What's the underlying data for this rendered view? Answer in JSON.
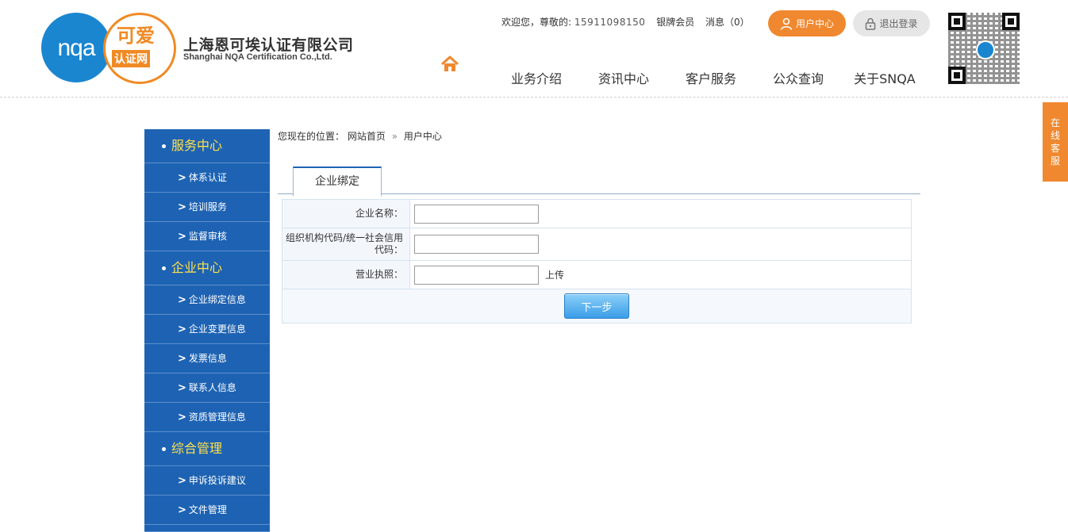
{
  "header": {
    "logo_left_text": "nqa",
    "logo_right_line1": "可爱",
    "logo_right_line2": "认证网",
    "company_cn": "上海恩可埃认证有限公司",
    "company_en": "Shanghai NQA Certification Co.,Ltd.",
    "welcome_prefix": "欢迎您，尊敬的:",
    "phone": "15911098150",
    "member_level": "银牌会员",
    "messages": "消息（0）",
    "user_center_label": "用户中心",
    "logout_label": "退出登录",
    "nav": [
      "业务介绍",
      "资讯中心",
      "客户服务",
      "公众查询",
      "关于SNQA"
    ]
  },
  "sidebar": {
    "sections": [
      {
        "title": "服务中心",
        "items": [
          "体系认证",
          "培训服务",
          "监督审核"
        ]
      },
      {
        "title": "企业中心",
        "items": [
          "企业绑定信息",
          "企业变更信息",
          "发票信息",
          "联系人信息",
          "资质管理信息"
        ]
      },
      {
        "title": "综合管理",
        "items": [
          "申诉投诉建议",
          "文件管理"
        ]
      }
    ]
  },
  "breadcrumb": {
    "prefix": "您现在的位置：",
    "home": "网站首页",
    "separator": "»",
    "current": "用户中心"
  },
  "tab": {
    "label": "企业绑定"
  },
  "form": {
    "company_name_label": "企业名称：",
    "company_name_value": "",
    "org_code_label": "组织机构代码/统一社会信用代码：",
    "org_code_value": "",
    "license_label": "营业执照：",
    "license_value": "",
    "upload_label": "上传",
    "next_label": "下一步"
  },
  "float_service": [
    "在",
    "线",
    "客",
    "服"
  ],
  "colors": {
    "brand_blue": "#1a86d0",
    "sidebar_blue": "#1e63b3",
    "accent_orange": "#f0882f",
    "sidebar_title_yellow": "#ffe04a"
  }
}
